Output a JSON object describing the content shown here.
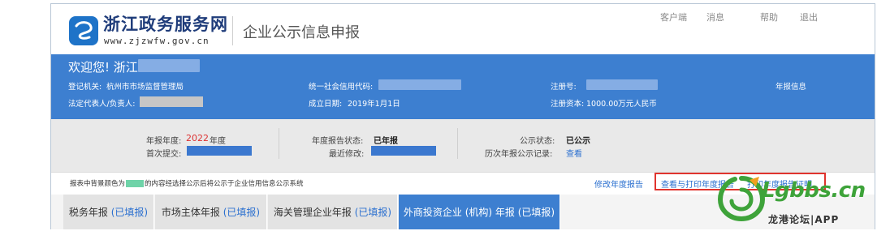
{
  "header": {
    "site_name": "浙江政务服务网",
    "site_url": "www.zjzwfw.gov.cn",
    "portal_title": "企业公示信息申报",
    "links": [
      "客户端",
      "消息",
      "帮助",
      "退出"
    ]
  },
  "company": {
    "welcome": "欢迎您! 浙江",
    "authority_label": "登记机关:",
    "authority_value": "杭州市市场监督管理局",
    "credit_code_label": "统一社会信用代码:",
    "reg_no_label": "注册号:",
    "annual_info_link": "年报信息",
    "legal_rep_label": "法定代表人/负责人:",
    "founded_label": "成立日期:",
    "founded_value": "2019年1月1日",
    "capital_label": "注册资本:",
    "capital_value": "1000.00万元人民币"
  },
  "report": {
    "year_label": "年报年度:",
    "year_value": "2022",
    "year_unit": "年度",
    "first_submit_label": "首次提交:",
    "status_label": "年度报告状态:",
    "status_value": "已年报",
    "last_modified_label": "最近修改:",
    "publicity_label": "公示状态:",
    "publicity_value": "已公示",
    "history_label": "历次年报公示记录:",
    "history_link": "查看"
  },
  "notice": {
    "text_before": "报表中背景颜色为",
    "text_after": "的内容经选择公示后将公示于企业信用信息公示系统"
  },
  "actions": {
    "modify": "修改年度报告",
    "view_print": "查看与打印年度报告",
    "print_cert": "打印年度报告证明"
  },
  "tabs": [
    {
      "label": "税务年报",
      "status": "(已填报)"
    },
    {
      "label": "市场主体年报",
      "status": "(已填报)"
    },
    {
      "label": "海关管理企业年报",
      "status": "(已填报)"
    },
    {
      "label": "外商投资企业 (机构) 年报",
      "status": "(已填报)"
    }
  ],
  "watermark": {
    "brand": "Lgbbs.cn",
    "sub": "龙港论坛|APP"
  },
  "colors": {
    "band_blue": "#3d7fd0",
    "link_blue": "#2a6fcf",
    "highlight_red": "#e0342e",
    "year_red": "#d33",
    "public_green": "#6fd3a8"
  }
}
